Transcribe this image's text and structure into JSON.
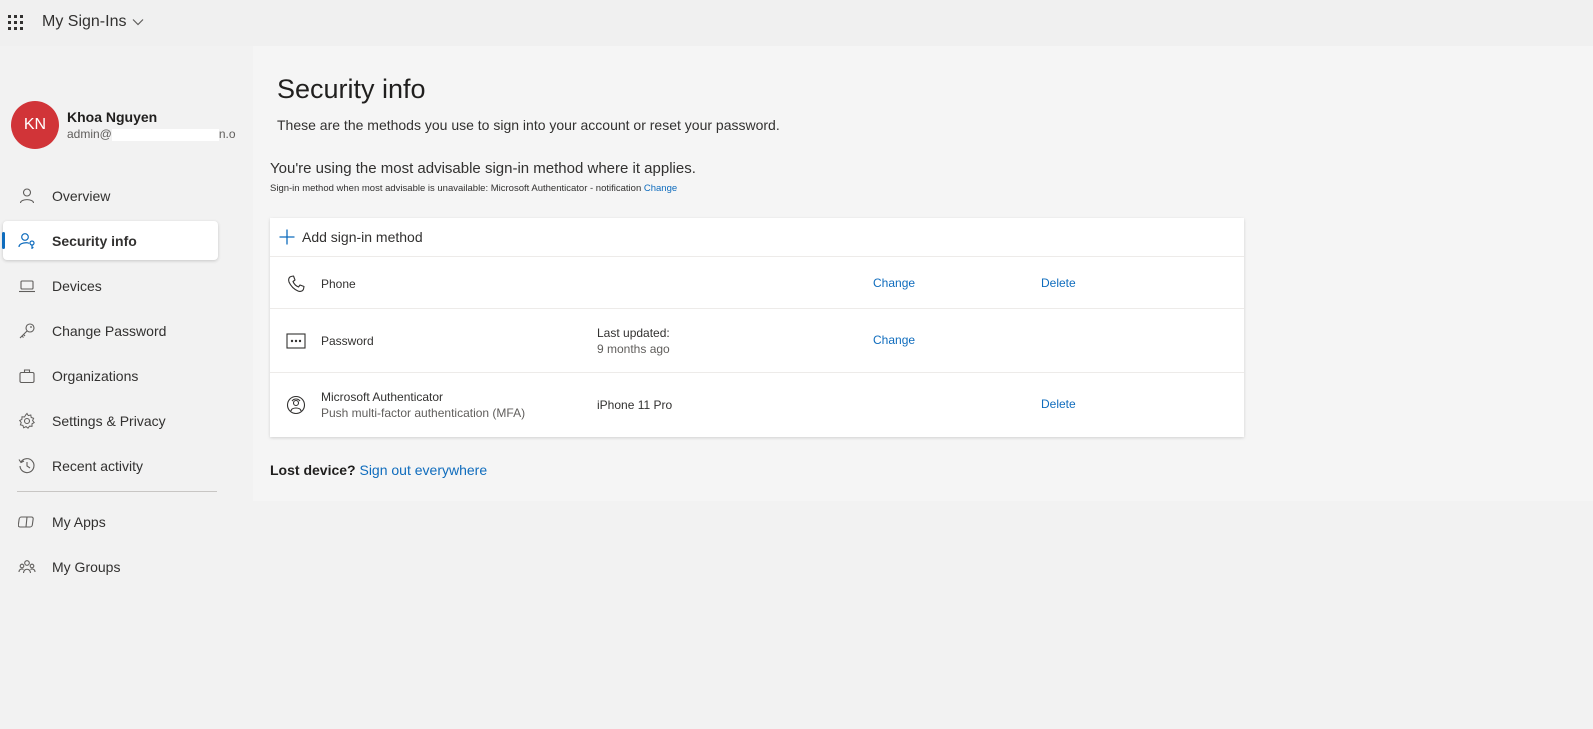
{
  "header": {
    "app_title": "My Sign-Ins"
  },
  "profile": {
    "initials": "KN",
    "name": "Khoa Nguyen",
    "email_prefix": "admin@",
    "email_suffix": "n.o",
    "avatar_color": "#d13438"
  },
  "nav": {
    "items": [
      {
        "label": "Overview",
        "icon": "person-icon"
      },
      {
        "label": "Security info",
        "icon": "person-key-icon",
        "active": true
      },
      {
        "label": "Devices",
        "icon": "laptop-icon"
      },
      {
        "label": "Change Password",
        "icon": "key-icon"
      },
      {
        "label": "Organizations",
        "icon": "briefcase-icon"
      },
      {
        "label": "Settings & Privacy",
        "icon": "gear-icon"
      },
      {
        "label": "Recent activity",
        "icon": "history-icon"
      }
    ],
    "secondary": [
      {
        "label": "My Apps",
        "icon": "apps-icon"
      },
      {
        "label": "My Groups",
        "icon": "people-icon"
      }
    ]
  },
  "main": {
    "title": "Security info",
    "description": "These are the methods you use to sign into your account or reset your password.",
    "advisable": "You're using the most advisable sign-in method where it applies.",
    "fallback_text": "Sign-in method when most advisable is unavailable: Microsoft Authenticator - notification",
    "fallback_link": "Change",
    "add_method": "Add sign-in method",
    "methods": [
      {
        "name": "Phone",
        "sub": "",
        "detail": "",
        "detail_sub": "",
        "action1": "Change",
        "action2": "Delete",
        "icon": "phone-icon"
      },
      {
        "name": "Password",
        "sub": "",
        "detail": "Last updated:",
        "detail_sub": "9 months ago",
        "action1": "Change",
        "action2": "",
        "icon": "password-icon"
      },
      {
        "name": "Microsoft Authenticator",
        "sub": "Push multi-factor authentication (MFA)",
        "detail": "iPhone 11 Pro",
        "detail_sub": "",
        "action1": "",
        "action2": "Delete",
        "icon": "authenticator-icon"
      }
    ],
    "lost_device_label": "Lost device?",
    "sign_out_link": "Sign out everywhere"
  },
  "colors": {
    "accent": "#0f6cbd"
  }
}
